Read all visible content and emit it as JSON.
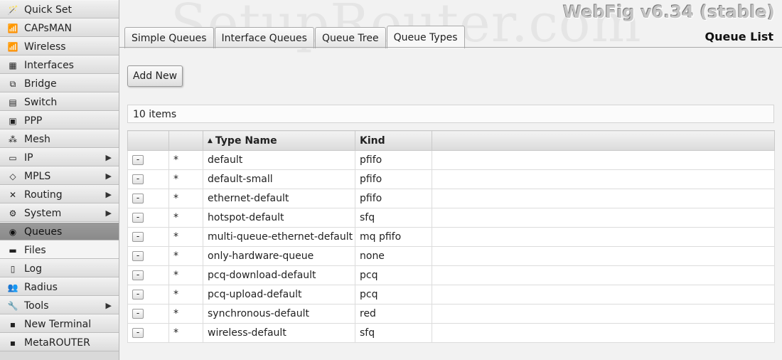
{
  "sidebar": {
    "items": [
      {
        "label": "Quick Set",
        "icon": "wand-icon",
        "glyph": "🪄",
        "arrow": false,
        "state": ""
      },
      {
        "label": "CAPsMAN",
        "icon": "antenna-icon",
        "glyph": "📶",
        "arrow": false,
        "state": ""
      },
      {
        "label": "Wireless",
        "icon": "antenna-icon",
        "glyph": "📶",
        "arrow": false,
        "state": ""
      },
      {
        "label": "Interfaces",
        "icon": "interfaces-icon",
        "glyph": "▦",
        "arrow": false,
        "state": ""
      },
      {
        "label": "Bridge",
        "icon": "bridge-icon",
        "glyph": "⧉",
        "arrow": false,
        "state": ""
      },
      {
        "label": "Switch",
        "icon": "switch-icon",
        "glyph": "▤",
        "arrow": false,
        "state": ""
      },
      {
        "label": "PPP",
        "icon": "ppp-icon",
        "glyph": "▣",
        "arrow": false,
        "state": ""
      },
      {
        "label": "Mesh",
        "icon": "mesh-icon",
        "glyph": "⁂",
        "arrow": false,
        "state": ""
      },
      {
        "label": "IP",
        "icon": "ip-icon",
        "glyph": "▭",
        "arrow": true,
        "state": ""
      },
      {
        "label": "MPLS",
        "icon": "mpls-icon",
        "glyph": "◇",
        "arrow": true,
        "state": ""
      },
      {
        "label": "Routing",
        "icon": "routing-icon",
        "glyph": "✕",
        "arrow": true,
        "state": ""
      },
      {
        "label": "System",
        "icon": "gear-icon",
        "glyph": "⚙",
        "arrow": true,
        "state": ""
      },
      {
        "label": "Queues",
        "icon": "queues-icon",
        "glyph": "◉",
        "arrow": false,
        "state": "active"
      },
      {
        "label": "Files",
        "icon": "folder-icon",
        "glyph": "▬",
        "arrow": false,
        "state": "lite"
      },
      {
        "label": "Log",
        "icon": "log-icon",
        "glyph": "▯",
        "arrow": false,
        "state": ""
      },
      {
        "label": "Radius",
        "icon": "users-icon",
        "glyph": "👥",
        "arrow": false,
        "state": ""
      },
      {
        "label": "Tools",
        "icon": "tools-icon",
        "glyph": "🔧",
        "arrow": true,
        "state": ""
      },
      {
        "label": "New Terminal",
        "icon": "terminal-icon",
        "glyph": "▪",
        "arrow": false,
        "state": ""
      },
      {
        "label": "MetaROUTER",
        "icon": "metarouter-icon",
        "glyph": "▪",
        "arrow": false,
        "state": ""
      }
    ],
    "arrow_glyph": "▶"
  },
  "header": {
    "watermark": "SetupRouter.com",
    "app_title": "WebFig v6.34 (stable)",
    "page_title": "Queue List"
  },
  "tabs": [
    {
      "label": "Simple Queues",
      "selected": false
    },
    {
      "label": "Interface Queues",
      "selected": false
    },
    {
      "label": "Queue Tree",
      "selected": false
    },
    {
      "label": "Queue Types",
      "selected": true
    }
  ],
  "toolbar": {
    "add_label": "Add New"
  },
  "list": {
    "count_text": "10 items"
  },
  "table": {
    "sort_arrow": "▲",
    "columns": [
      "",
      "",
      "Type Name",
      "Kind",
      ""
    ],
    "remove_glyph": "-",
    "rows": [
      {
        "flag": "*",
        "name": "default",
        "kind": "pfifo"
      },
      {
        "flag": "*",
        "name": "default-small",
        "kind": "pfifo"
      },
      {
        "flag": "*",
        "name": "ethernet-default",
        "kind": "pfifo"
      },
      {
        "flag": "*",
        "name": "hotspot-default",
        "kind": "sfq"
      },
      {
        "flag": "*",
        "name": "multi-queue-ethernet-default",
        "kind": "mq pfifo"
      },
      {
        "flag": "*",
        "name": "only-hardware-queue",
        "kind": "none"
      },
      {
        "flag": "*",
        "name": "pcq-download-default",
        "kind": "pcq"
      },
      {
        "flag": "*",
        "name": "pcq-upload-default",
        "kind": "pcq"
      },
      {
        "flag": "*",
        "name": "synchronous-default",
        "kind": "red"
      },
      {
        "flag": "*",
        "name": "wireless-default",
        "kind": "sfq"
      }
    ]
  }
}
